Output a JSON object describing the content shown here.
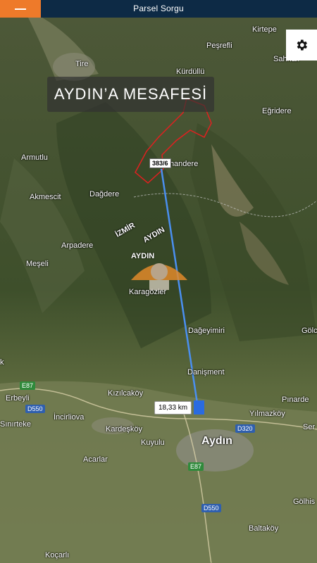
{
  "app": {
    "title": "Parsel Sorgu"
  },
  "toolbar": {
    "menu_icon": "hamburger-icon",
    "settings_icon": "gear-icon"
  },
  "overlay": {
    "title": "AYDIN’A MESAFESİ",
    "parcel_label": "383/6",
    "distance_label": "18,33 km"
  },
  "colors": {
    "topbar": "#0d2a45",
    "menu_button": "#ee7a2a",
    "route_line": "#4a8ff0",
    "parcel_outline": "#e02020",
    "endpoint": "#2a6be0"
  },
  "map_labels": {
    "kirtepe": "Kirtepe",
    "pesrefli": "Peşrefli",
    "sahnali": "Sahnalı",
    "tire": "Tire",
    "kurdullu": "Kürdüllü",
    "egridere": "Eğridere",
    "armutlu": "Armutlu",
    "chandere": "Çhandere",
    "akmescit": "Akmescit",
    "dagdere": "Dağdere",
    "izmir": "İZMİR",
    "arpadere": "Arpadere",
    "aydin_prov": "AYDIN",
    "meseli": "Meşeli",
    "karagozler": "Karagözler",
    "dageyimiri": "Dağeyimiri",
    "golcuk": "Gölcü",
    "danisment": "Danişment",
    "kizilcakoy": "Kızılcaköy",
    "erbeyli": "Erbeyli",
    "pinardere": "Pınarde",
    "yilmazkoy": "Yılmazköy",
    "sinirteke": "Sınırteke",
    "incirliova": "İncirliova",
    "kardeskoy": "Kardeşköy",
    "kuyulu": "Kuyulu",
    "aydin": "Aydın",
    "acarlar": "Acarlar",
    "golhis": "Gölhis",
    "baltakoy": "Baltaköy",
    "kocarli": "Koçarlı",
    "ser": "Ser",
    "k": "k"
  },
  "road_labels": {
    "e87_a": "E87",
    "d550_a": "D550",
    "d320": "D320",
    "e87_b": "E87",
    "d550_b": "D550"
  },
  "logo": {
    "text": "AYDIN"
  }
}
